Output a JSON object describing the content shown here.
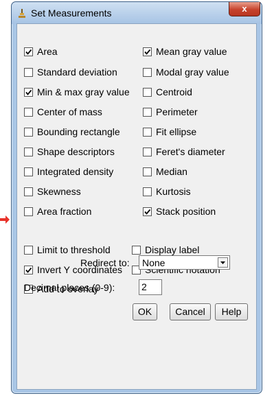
{
  "window": {
    "title": "Set Measurements",
    "close_glyph": "x",
    "icon": "imagej-microscope-icon"
  },
  "measurements": [
    {
      "label": "Area",
      "checked": true
    },
    {
      "label": "Mean gray value",
      "checked": true
    },
    {
      "label": "Standard deviation",
      "checked": false
    },
    {
      "label": "Modal gray value",
      "checked": false
    },
    {
      "label": "Min & max gray value",
      "checked": true
    },
    {
      "label": "Centroid",
      "checked": false
    },
    {
      "label": "Center of mass",
      "checked": false
    },
    {
      "label": "Perimeter",
      "checked": false
    },
    {
      "label": "Bounding rectangle",
      "checked": false
    },
    {
      "label": "Fit ellipse",
      "checked": false
    },
    {
      "label": "Shape descriptors",
      "checked": false
    },
    {
      "label": "Feret's diameter",
      "checked": false
    },
    {
      "label": "Integrated density",
      "checked": false
    },
    {
      "label": "Median",
      "checked": false
    },
    {
      "label": "Skewness",
      "checked": false
    },
    {
      "label": "Kurtosis",
      "checked": false
    },
    {
      "label": "Area fraction",
      "checked": false
    },
    {
      "label": "Stack position",
      "checked": true
    }
  ],
  "options": [
    {
      "label": "Limit to threshold",
      "checked": false
    },
    {
      "label": "Display label",
      "checked": false
    },
    {
      "label": "Invert Y coordinates",
      "checked": true
    },
    {
      "label": "Scientific notation",
      "checked": false
    },
    {
      "label": "Add to overlay",
      "checked": false
    }
  ],
  "redirect": {
    "label": "Redirect to:",
    "value": "None"
  },
  "decimal": {
    "label": "Decimal places (0-9):",
    "value": "2"
  },
  "buttons": {
    "ok": "OK",
    "cancel": "Cancel",
    "help": "Help"
  },
  "colors": {
    "accent_arrow": "#e8322a",
    "window_frame": "#a9c6e6"
  }
}
